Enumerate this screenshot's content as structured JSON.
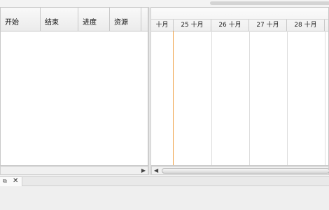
{
  "grid": {
    "columns": [
      "开始",
      "结束",
      "进度",
      "资源"
    ]
  },
  "gantt": {
    "days": [
      "十月",
      "25 十月",
      "26 十月",
      "27 十月",
      "28 十月"
    ]
  },
  "icons": {
    "scroll_right": "arrow-right-icon",
    "scroll_left": "arrow-left-icon",
    "restore": "restore-icon",
    "close": "close-icon"
  }
}
